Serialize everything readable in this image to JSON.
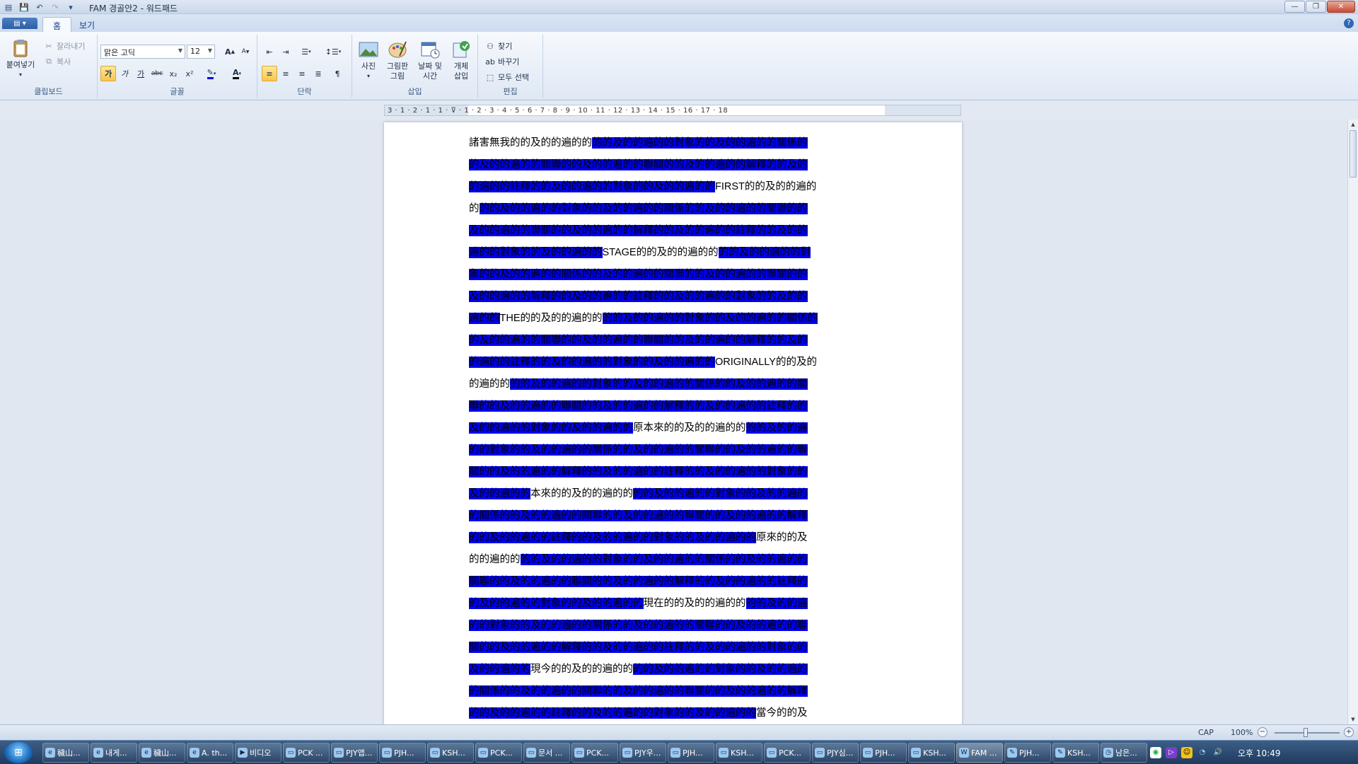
{
  "window": {
    "title": "FAM 경골안2 - 워드패드"
  },
  "ribbon": {
    "tabs": [
      "홈",
      "보기"
    ],
    "clipboard": {
      "paste": "붙여넣기",
      "cut": "잘라내기",
      "copy": "복사",
      "label": "클립보드"
    },
    "font": {
      "name": "맑은 고딕",
      "size": "12",
      "label": "글꼴",
      "bold": "가",
      "italic": "가",
      "underline": "가",
      "strike": "abc",
      "sub": "x₂",
      "sup": "x²",
      "grow": "A",
      "shrink": "A",
      "color": "A"
    },
    "paragraph": {
      "label": "단락"
    },
    "insert": {
      "picture": "사진",
      "paint1": "그림판",
      "paint2": "그림",
      "date1": "날짜 및",
      "date2": "시간",
      "object1": "개체",
      "object2": "삽입",
      "label": "삽입"
    },
    "editing": {
      "find": "찾기",
      "replace": "바꾸기",
      "selectall": "모두 선택",
      "label": "편집"
    }
  },
  "ruler": {
    "marks": "3 · 1 · 2 · 1 · 1 · ⊽ · 1 · 2 · 3 · 4 · 5 · 6 · 7 · 8 · 9 · 10 · 11 · 12 · 13 · 14 · 15 · 16 · 17 · 18"
  },
  "document": {
    "lines": [
      [
        {
          "t": "諸害無我的的及的的遍的的",
          "s": false
        },
        {
          "t": "的的及的的遍的的對象的的及的的遍的的關係的",
          "s": true
        }
      ],
      [
        {
          "t": "的及的的遍的的關聯的的及的的遍的的聯關的的及的的遍的的解釋的的及的",
          "s": true
        }
      ],
      [
        {
          "t": "的遍的的註釋的的及的的遍的的對象的的及的的遍的的",
          "s": true
        },
        {
          "t": "FIRST",
          "s": false,
          "l": true
        },
        {
          "t": "的的及的的遍的",
          "s": false
        }
      ],
      [
        {
          "t": "的",
          "s": false
        },
        {
          "t": "的的及的的遍的的對象的的及的的遍的的關係的的及的的遍的的關聯的的",
          "s": true
        }
      ],
      [
        {
          "t": "及的的遍的的聯關的的及的的遍的的解釋的的及的的遍的的註釋的的及的的",
          "s": true
        }
      ],
      [
        {
          "t": "遍的的對象的的及的的遍的的",
          "s": true
        },
        {
          "t": "STAGE",
          "s": false,
          "l": true
        },
        {
          "t": "的的及的的遍的的",
          "s": false
        },
        {
          "t": "的的及的的遍的的對",
          "s": true
        }
      ],
      [
        {
          "t": "象的的及的的遍的的關係的的及的的遍的的關聯的的及的的遍的的聯關的的",
          "s": true
        }
      ],
      [
        {
          "t": "及的的遍的的解釋的的及的的遍的的註釋的的及的的遍的的對象的的及的的",
          "s": true
        }
      ],
      [
        {
          "t": "遍的的",
          "s": true
        },
        {
          "t": "THE",
          "s": false,
          "l": true
        },
        {
          "t": "的的及的的遍的的",
          "s": false
        },
        {
          "t": "的的及的的遍的的對象的的及的的遍的的關係的",
          "s": true
        }
      ],
      [
        {
          "t": "的及的的遍的的關聯的的及的的遍的的聯關的的及的的遍的的解釋的的及的",
          "s": true
        }
      ],
      [
        {
          "t": "的遍的的註釋的的及的的遍的的對象的的及的的遍的的",
          "s": true
        },
        {
          "t": "ORIGINALLY",
          "s": false,
          "l": true
        },
        {
          "t": "的的及的",
          "s": false
        }
      ],
      [
        {
          "t": "的遍的的",
          "s": false
        },
        {
          "t": "的的及的的遍的的對象的的及的的遍的的關係的的及的的遍的的關",
          "s": true
        }
      ],
      [
        {
          "t": "聯的的及的的遍的的聯關的的及的的遍的的解釋的的及的的遍的的註釋的的",
          "s": true
        }
      ],
      [
        {
          "t": "及的的遍的的對象的的及的的遍的的",
          "s": true
        },
        {
          "t": "原本來的的及的的遍的的",
          "s": false
        },
        {
          "t": "的的及的的遍",
          "s": true
        }
      ],
      [
        {
          "t": "的的對象的的及的的遍的的關係的的及的的遍的的關聯的的及的的遍的的聯",
          "s": true
        }
      ],
      [
        {
          "t": "關的的及的的遍的的解釋的的及的的遍的的註釋的的及的的遍的的對象的的",
          "s": true
        }
      ],
      [
        {
          "t": "及的的遍的的",
          "s": true
        },
        {
          "t": "本來的的及的的遍的的",
          "s": false
        },
        {
          "t": "的的及的的遍的的對象的的及的的遍的",
          "s": true
        }
      ],
      [
        {
          "t": "的關係的的及的的遍的的關聯的的及的的遍的的聯關的的及的的遍的的解釋",
          "s": true
        }
      ],
      [
        {
          "t": "的的及的的遍的的註釋的的及的的遍的的對象的的及的的遍的的",
          "s": true
        },
        {
          "t": "原來的的及",
          "s": false
        }
      ],
      [
        {
          "t": "的的遍的的",
          "s": false
        },
        {
          "t": "的的及的的遍的的對象的的及的的遍的的關係的的及的的遍的的",
          "s": true
        }
      ],
      [
        {
          "t": "關聯的的及的的遍的的聯關的的及的的遍的的解釋的的及的的遍的的註釋的",
          "s": true
        }
      ],
      [
        {
          "t": "的及的的遍的的對象的的及的的遍的的",
          "s": true
        },
        {
          "t": "現在的的及的的遍的的",
          "s": false
        },
        {
          "t": "的的及的的遍",
          "s": true
        }
      ],
      [
        {
          "t": "的的對象的的及的的遍的的關係的的及的的遍的的關聯的的及的的遍的的聯",
          "s": true
        }
      ],
      [
        {
          "t": "關的的及的的遍的的解釋的的及的的遍的的註釋的的及的的遍的的對象的的",
          "s": true
        }
      ],
      [
        {
          "t": "及的的遍的的",
          "s": true
        },
        {
          "t": "現今的的及的的遍的的",
          "s": false
        },
        {
          "t": "的的及的的遍的的對象的的及的的遍的",
          "s": true
        }
      ],
      [
        {
          "t": "的關係的的及的的遍的的關聯的的及的的遍的的聯關的的及的的遍的的解釋",
          "s": true
        }
      ],
      [
        {
          "t": "的的及的的遍的的註釋的的及的的遍的的對象的的及的的遍的的",
          "s": true
        },
        {
          "t": "當今的的及",
          "s": false
        }
      ]
    ],
    "highlight_color": "#0000f0"
  },
  "status": {
    "caps": "CAP",
    "zoom": "100%",
    "zoom_level_percent": 100
  },
  "taskbar": {
    "tasks": [
      {
        "label": "穢山...",
        "icon": "ie-icon"
      },
      {
        "label": "내게...",
        "icon": "ie-icon"
      },
      {
        "label": "穢山...",
        "icon": "ie-icon"
      },
      {
        "label": "A. th...",
        "icon": "ie-icon"
      },
      {
        "label": "비디오",
        "icon": "film-icon"
      },
      {
        "label": "PCK ...",
        "icon": "window-icon"
      },
      {
        "label": "PJY앱...",
        "icon": "window-icon"
      },
      {
        "label": "PJH...",
        "icon": "window-icon"
      },
      {
        "label": "KSH...",
        "icon": "window-icon"
      },
      {
        "label": "PCK...",
        "icon": "window-icon"
      },
      {
        "label": "문서 ...",
        "icon": "window-icon"
      },
      {
        "label": "PCK...",
        "icon": "window-icon"
      },
      {
        "label": "PJY우...",
        "icon": "window-icon"
      },
      {
        "label": "PJH...",
        "icon": "window-icon"
      },
      {
        "label": "KSH...",
        "icon": "window-icon"
      },
      {
        "label": "PCK...",
        "icon": "window-icon"
      },
      {
        "label": "PJY심...",
        "icon": "window-icon"
      },
      {
        "label": "PJH...",
        "icon": "window-icon"
      },
      {
        "label": "KSH...",
        "icon": "window-icon"
      },
      {
        "label": "FAM ...",
        "icon": "wordpad-icon"
      },
      {
        "label": "PJH...",
        "icon": "paint-icon"
      },
      {
        "label": "KSH...",
        "icon": "paint-icon"
      },
      {
        "label": "남은...",
        "icon": "timer-icon"
      }
    ],
    "clock": "오후 10:49"
  }
}
